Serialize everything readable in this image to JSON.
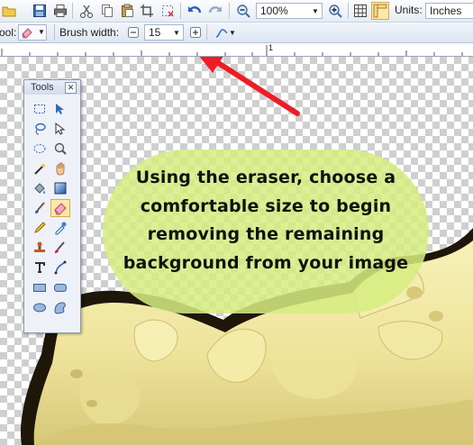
{
  "toolbar": {
    "zoom_value": "100%",
    "units_label": "Units:",
    "units_value": "Inches"
  },
  "tool_options": {
    "tool_label": "ool:",
    "brush_width_label": "Brush width:",
    "brush_width_value": "15"
  },
  "ruler": {
    "mark": "1"
  },
  "tools_window": {
    "title": "Tools",
    "tools": [
      "rectangle-select",
      "move-selection",
      "lasso-select",
      "move-selected",
      "ellipse-select",
      "zoom",
      "magic-wand",
      "pan",
      "paint-bucket",
      "gradient",
      "paintbrush",
      "eraser",
      "pencil",
      "color-picker",
      "clone-stamp",
      "recolor",
      "text",
      "line-curve",
      "rectangle",
      "rounded-rectangle",
      "ellipse",
      "freeform-shape"
    ],
    "selected_tool": "eraser"
  },
  "callout": {
    "text": "Using the eraser, choose a\ncomfortable size to begin\nremoving the remaining\nbackground from your image"
  },
  "colors": {
    "callout_fill": "#d6ec80",
    "arrow": "#ee1c24",
    "shell": "#f2eba4",
    "shell_shadow": "#1e1608"
  }
}
